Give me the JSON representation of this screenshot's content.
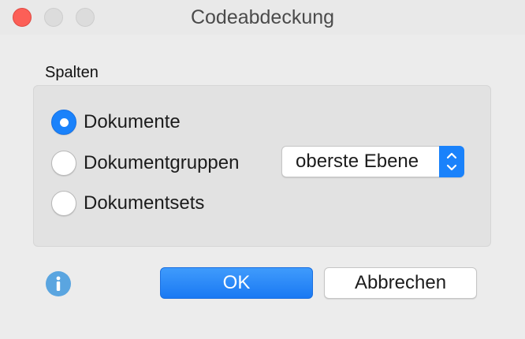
{
  "window": {
    "title": "Codeabdeckung"
  },
  "section": {
    "label": "Spalten"
  },
  "options": [
    {
      "label": "Dokumente",
      "selected": true
    },
    {
      "label": "Dokumentgruppen",
      "selected": false
    },
    {
      "label": "Dokumentsets",
      "selected": false
    }
  ],
  "level_select": {
    "value": "oberste Ebene"
  },
  "buttons": {
    "ok_label": "OK",
    "cancel_label": "Abbrechen"
  },
  "colors": {
    "accent": "#1a82fb",
    "close": "#fc5f57",
    "info": "#5aa5e0"
  },
  "icons": {
    "info": "info-icon",
    "select_arrows": "chevron-up-down-icon"
  }
}
